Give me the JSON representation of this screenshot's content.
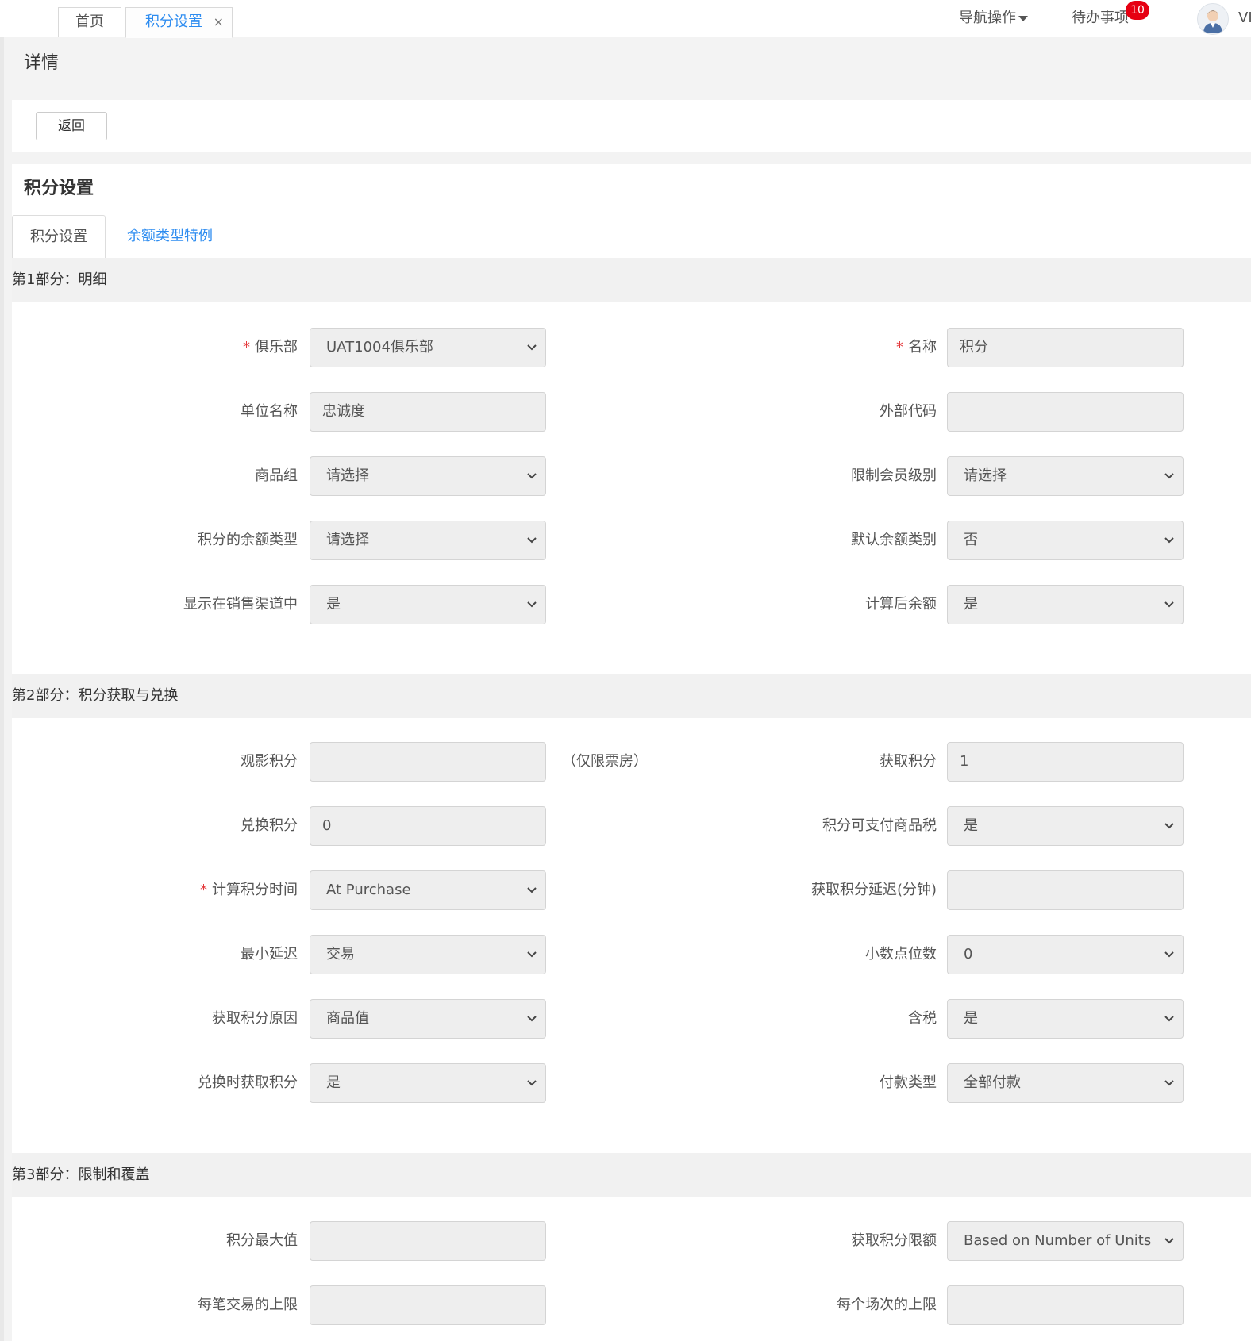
{
  "topbar": {
    "tabs": [
      {
        "label": "首页"
      },
      {
        "label": "积分设置",
        "close": "×"
      }
    ],
    "nav_ops": "导航操作",
    "todo": "待办事项",
    "todo_count": "10",
    "user": "VI"
  },
  "page": {
    "detail_title": "详情",
    "back_label": "返回",
    "section_title": "积分设置",
    "subtabs": [
      "积分设置",
      "余额类型特例"
    ]
  },
  "part1": {
    "title": "第1部分：明细",
    "club": {
      "label": "俱乐部",
      "value": "UAT1004俱乐部"
    },
    "name": {
      "label": "名称",
      "value": "积分"
    },
    "unit_name": {
      "label": "单位名称",
      "value": "忠诚度"
    },
    "external_code": {
      "label": "外部代码",
      "value": ""
    },
    "product_group": {
      "label": "商品组",
      "value": "请选择"
    },
    "member_level": {
      "label": "限制会员级别",
      "value": "请选择"
    },
    "balance_type": {
      "label": "积分的余额类型",
      "value": "请选择"
    },
    "default_balance": {
      "label": "默认余额类别",
      "value": "否"
    },
    "show_in_channel": {
      "label": "显示在销售渠道中",
      "value": "是"
    },
    "calc_after_balance": {
      "label": "计算后余额",
      "value": "是"
    }
  },
  "part2": {
    "title": "第2部分：积分获取与兑换",
    "movie_points": {
      "label": "观影积分",
      "value": "",
      "note": "（仅限票房）"
    },
    "earn_points": {
      "label": "获取积分",
      "value": "1"
    },
    "redeem_points": {
      "label": "兑换积分",
      "value": "0"
    },
    "pay_tax": {
      "label": "积分可支付商品税",
      "value": "是"
    },
    "calc_time": {
      "label": "计算积分时间",
      "value": "At Purchase"
    },
    "earn_delay": {
      "label": "获取积分延迟(分钟)",
      "value": ""
    },
    "min_delay": {
      "label": "最小延迟",
      "value": "交易"
    },
    "decimals": {
      "label": "小数点位数",
      "value": "0"
    },
    "earn_reason": {
      "label": "获取积分原因",
      "value": "商品值"
    },
    "tax_included": {
      "label": "含税",
      "value": "是"
    },
    "earn_on_redeem": {
      "label": "兑换时获取积分",
      "value": "是"
    },
    "payment_type": {
      "label": "付款类型",
      "value": "全部付款"
    }
  },
  "part3": {
    "title": "第3部分：限制和覆盖",
    "max_points": {
      "label": "积分最大值",
      "value": ""
    },
    "earn_limit": {
      "label": "获取积分限额",
      "value": "Based on Number of Units"
    },
    "per_txn_limit": {
      "label": "每笔交易的上限",
      "value": ""
    },
    "per_session_limit": {
      "label": "每个场次的上限",
      "value": ""
    }
  },
  "icons": {
    "dropdown": "chevron-down-icon",
    "close": "close-icon",
    "caret": "caret-down-icon",
    "avatar": "user-avatar-icon"
  },
  "colors": {
    "accent": "#2d8cf0",
    "required": "#e4393c",
    "badge": "#e60012",
    "field_bg": "#eeeeee"
  }
}
